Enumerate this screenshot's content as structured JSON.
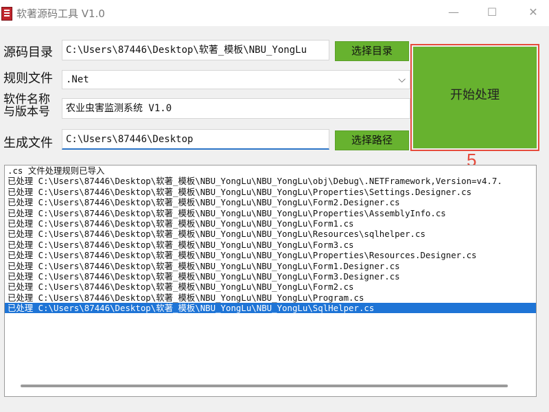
{
  "window": {
    "title": "软著源码工具 V1.0",
    "minimize": "—",
    "maximize": "☐",
    "close": "✕"
  },
  "form": {
    "source_dir": {
      "label": "源码目录",
      "value": "C:\\Users\\87446\\Desktop\\软著_模板\\NBU_YongLu",
      "button": "选择目录"
    },
    "rule_file": {
      "label": "规则文件",
      "value": ".Net"
    },
    "software": {
      "label_line1": "软件名称",
      "label_line2": "与版本号",
      "value": "农业虫害监测系统  V1.0"
    },
    "output": {
      "label": "生成文件",
      "value": "C:\\Users\\87446\\Desktop",
      "button": "选择路径"
    }
  },
  "start_button": "开始处理",
  "annotation": "5",
  "log": {
    "lines": [
      ".cs 文件处理规则已导入",
      "已处理 C:\\Users\\87446\\Desktop\\软著_模板\\NBU_YongLu\\NBU_YongLu\\obj\\Debug\\.NETFramework,Version=v4.7.",
      "已处理 C:\\Users\\87446\\Desktop\\软著_模板\\NBU_YongLu\\NBU_YongLu\\Properties\\Settings.Designer.cs",
      "已处理 C:\\Users\\87446\\Desktop\\软著_模板\\NBU_YongLu\\NBU_YongLu\\Form2.Designer.cs",
      "已处理 C:\\Users\\87446\\Desktop\\软著_模板\\NBU_YongLu\\NBU_YongLu\\Properties\\AssemblyInfo.cs",
      "已处理 C:\\Users\\87446\\Desktop\\软著_模板\\NBU_YongLu\\NBU_YongLu\\Form1.cs",
      "已处理 C:\\Users\\87446\\Desktop\\软著_模板\\NBU_YongLu\\NBU_YongLu\\Resources\\sqlhelper.cs",
      "已处理 C:\\Users\\87446\\Desktop\\软著_模板\\NBU_YongLu\\NBU_YongLu\\Form3.cs",
      "已处理 C:\\Users\\87446\\Desktop\\软著_模板\\NBU_YongLu\\NBU_YongLu\\Properties\\Resources.Designer.cs",
      "已处理 C:\\Users\\87446\\Desktop\\软著_模板\\NBU_YongLu\\NBU_YongLu\\Form1.Designer.cs",
      "已处理 C:\\Users\\87446\\Desktop\\软著_模板\\NBU_YongLu\\NBU_YongLu\\Form3.Designer.cs",
      "已处理 C:\\Users\\87446\\Desktop\\软著_模板\\NBU_YongLu\\NBU_YongLu\\Form2.cs",
      "已处理 C:\\Users\\87446\\Desktop\\软著_模板\\NBU_YongLu\\NBU_YongLu\\Program.cs",
      "已处理 C:\\Users\\87446\\Desktop\\软著_模板\\NBU_YongLu\\NBU_YongLu\\SqlHelper.cs"
    ],
    "selected_index": 13
  },
  "colors": {
    "accent_green": "#67b22f",
    "highlight_red": "#e64b3c",
    "selection_blue": "#1e74d6"
  },
  "icons": {
    "app": "app-book-icon"
  }
}
